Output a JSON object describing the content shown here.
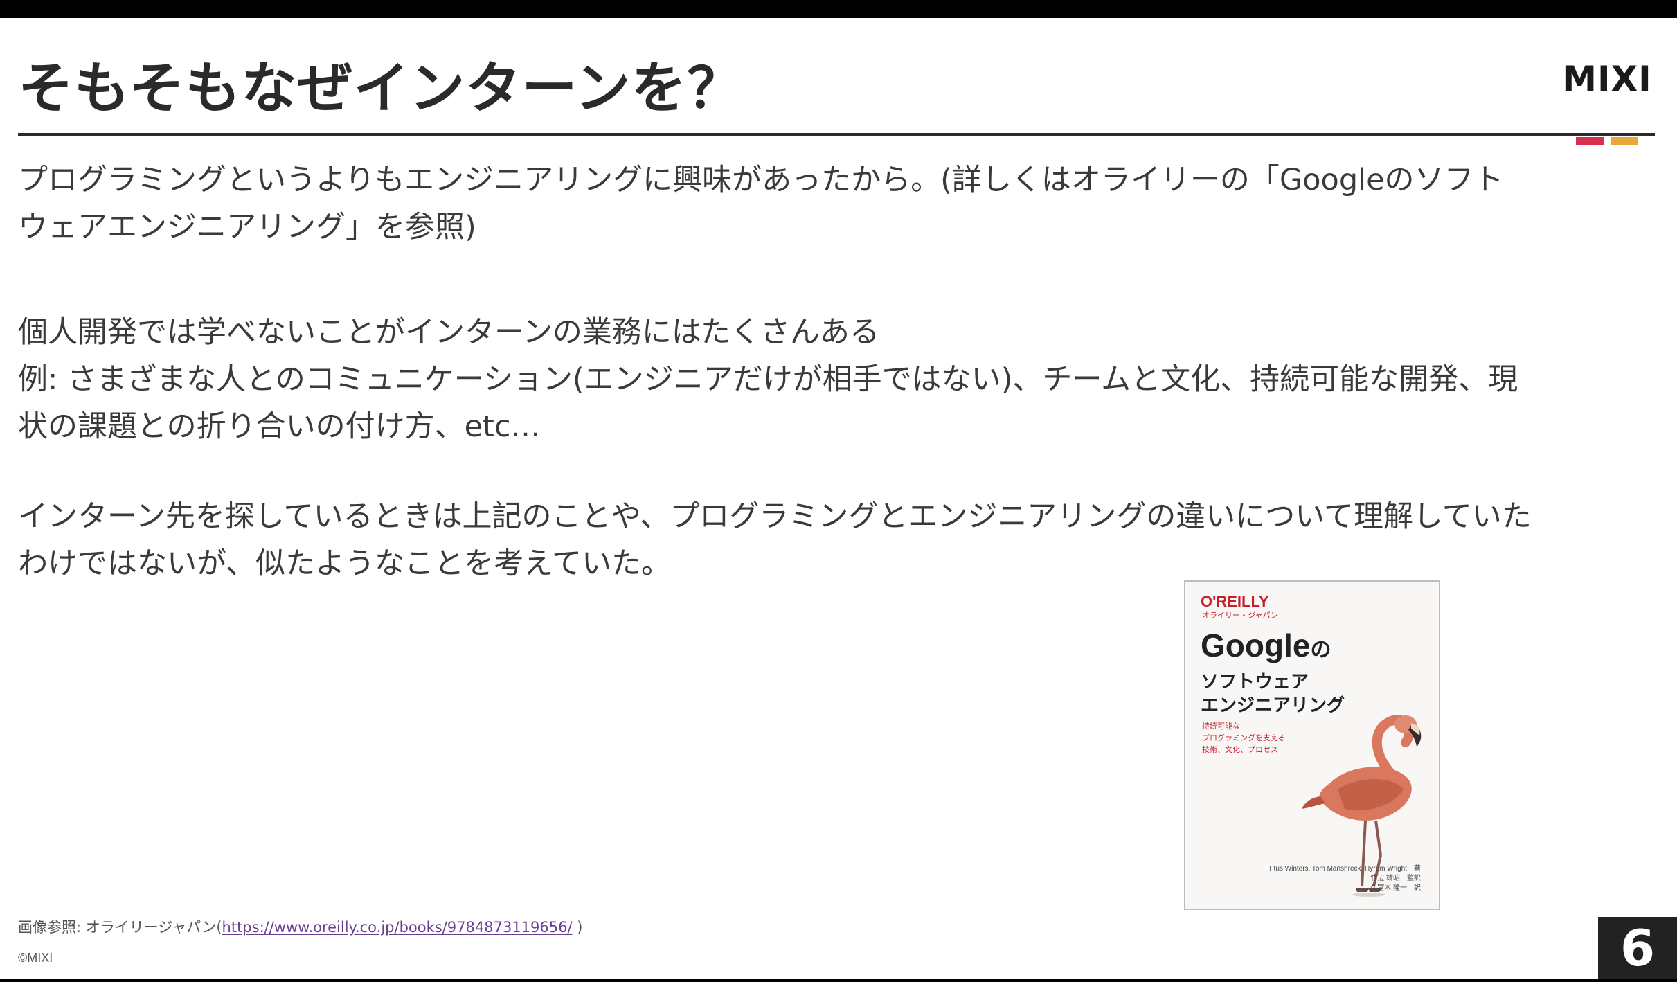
{
  "slide": {
    "title": "そもそもなぜインターンを？",
    "logo": {
      "text": "MIXI",
      "accent_colors": [
        "#d6304f",
        "#e8a83a"
      ]
    },
    "paragraphs": [
      {
        "lines": [
          "プログラミングというよりもエンジニアリングに興味があったから。(詳しくはオライリーの「Googleのソフト",
          "ウェアエンジニアリング」を参照)"
        ]
      },
      {
        "lines": [
          "個人開発では学べないことがインターンの業務にはたくさんある",
          "例: さまざまな人とのコミュニケーション(エンジニアだけが相手ではない)、チームと文化、持続可能な開発、現",
          "状の課題との折り合いの付け方、etc…"
        ]
      },
      {
        "lines": [
          "インターン先を探しているときは上記のことや、プログラミングとエンジニアリングの違いについて理解していた",
          "わけではないが、似たようなことを考えていた。"
        ]
      }
    ],
    "book_cover": {
      "publisher": "O'REILLY",
      "publisher_jp": "オライリー・ジャパン",
      "title_main": "Google",
      "title_no": "の",
      "subtitle_lines": [
        "ソフトウェア",
        "エンジニアリング"
      ],
      "tagline_lines": [
        "持続可能な",
        "プログラミングを支える",
        "技術、文化、プロセス"
      ],
      "authors_lines": [
        "Titus Winters, Tom Manshreck, Hyrum Wright　著",
        "竹辺 靖昭　監訳",
        "久富木 隆一　訳"
      ],
      "illustration": "flamingo"
    },
    "credit": {
      "prefix": "画像参照:  オライリージャパン(",
      "link": "https://www.oreilly.co.jp/books/9784873119656/",
      "suffix": " )"
    },
    "copyright": "©MIXI",
    "page_number": "6"
  }
}
